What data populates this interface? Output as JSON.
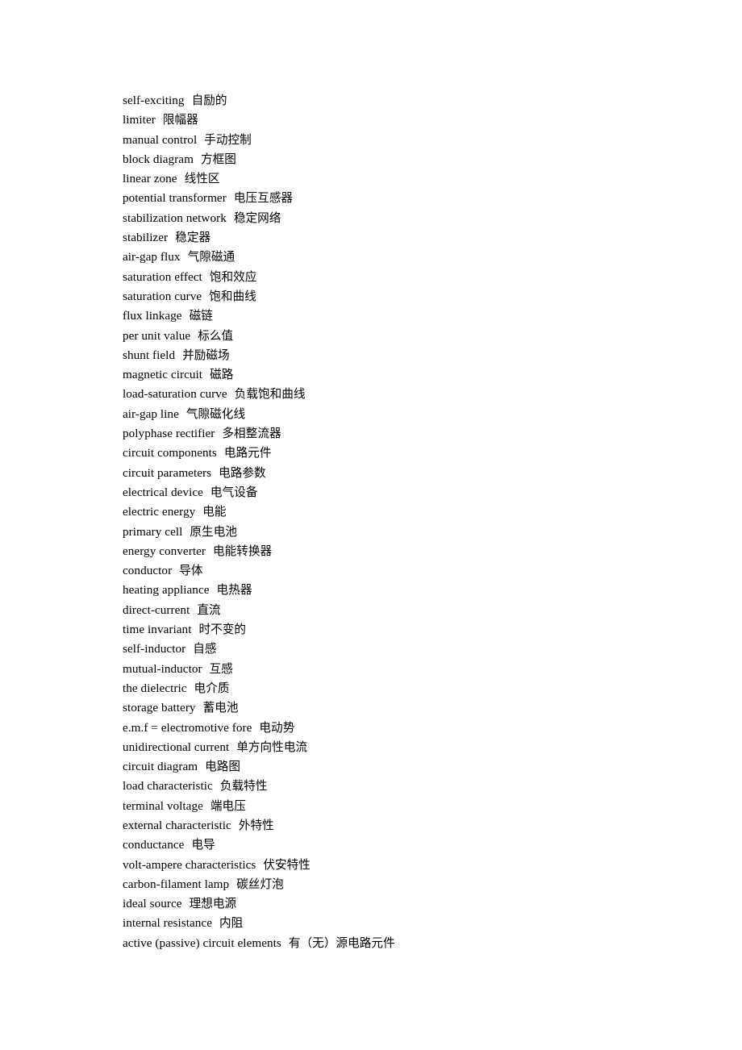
{
  "document": {
    "type": "glossary-list",
    "language_pair": "English-Chinese",
    "subject": "electrical engineering terminology",
    "entry_count": 44
  },
  "entries": [
    {
      "term": "self-exciting",
      "gloss": "自励的"
    },
    {
      "term": "limiter",
      "gloss": "限幅器"
    },
    {
      "term": "manual control",
      "gloss": "手动控制"
    },
    {
      "term": "block diagram",
      "gloss": "方框图"
    },
    {
      "term": "linear zone",
      "gloss": "线性区"
    },
    {
      "term": "potential transformer",
      "gloss": "电压互感器"
    },
    {
      "term": "stabilization network",
      "gloss": "稳定网络"
    },
    {
      "term": "stabilizer",
      "gloss": "稳定器"
    },
    {
      "term": "air-gap flux",
      "gloss": "气隙磁通"
    },
    {
      "term": "saturation effect",
      "gloss": "饱和效应"
    },
    {
      "term": "saturation curve",
      "gloss": "饱和曲线"
    },
    {
      "term": "flux linkage",
      "gloss": "磁链"
    },
    {
      "term": "per unit value",
      "gloss": "标么值"
    },
    {
      "term": "shunt field",
      "gloss": "并励磁场"
    },
    {
      "term": "magnetic circuit",
      "gloss": "磁路"
    },
    {
      "term": "load-saturation curve",
      "gloss": "负载饱和曲线"
    },
    {
      "term": "air-gap line",
      "gloss": "气隙磁化线"
    },
    {
      "term": "polyphase rectifier",
      "gloss": "多相整流器"
    },
    {
      "term": "circuit components",
      "gloss": "电路元件"
    },
    {
      "term": "circuit parameters",
      "gloss": "电路参数"
    },
    {
      "term": "electrical device",
      "gloss": "电气设备"
    },
    {
      "term": "electric energy",
      "gloss": "电能"
    },
    {
      "term": "primary cell",
      "gloss": "原生电池"
    },
    {
      "term": "energy converter",
      "gloss": "电能转换器"
    },
    {
      "term": "conductor",
      "gloss": "导体"
    },
    {
      "term": "heating appliance",
      "gloss": "电热器"
    },
    {
      "term": "direct-current",
      "gloss": "直流"
    },
    {
      "term": "time invariant",
      "gloss": "时不变的"
    },
    {
      "term": "self-inductor",
      "gloss": "自感"
    },
    {
      "term": "mutual-inductor",
      "gloss": "互感"
    },
    {
      "term": "the dielectric",
      "gloss": "电介质"
    },
    {
      "term": "storage battery",
      "gloss": "蓄电池"
    },
    {
      "term": "e.m.f = electromotive fore",
      "gloss": "电动势"
    },
    {
      "term": "unidirectional current",
      "gloss": "单方向性电流"
    },
    {
      "term": "circuit diagram",
      "gloss": "电路图"
    },
    {
      "term": "load characteristic",
      "gloss": "负载特性"
    },
    {
      "term": "terminal voltage",
      "gloss": "端电压"
    },
    {
      "term": "external characteristic",
      "gloss": "外特性"
    },
    {
      "term": "conductance",
      "gloss": "电导"
    },
    {
      "term": "volt-ampere characteristics",
      "gloss": "伏安特性"
    },
    {
      "term": "carbon-filament lamp",
      "gloss": "碳丝灯泡"
    },
    {
      "term": "ideal source",
      "gloss": "理想电源"
    },
    {
      "term": "internal resistance",
      "gloss": "内阻"
    },
    {
      "term": "active (passive) circuit elements",
      "gloss": "有（无）源电路元件"
    }
  ]
}
